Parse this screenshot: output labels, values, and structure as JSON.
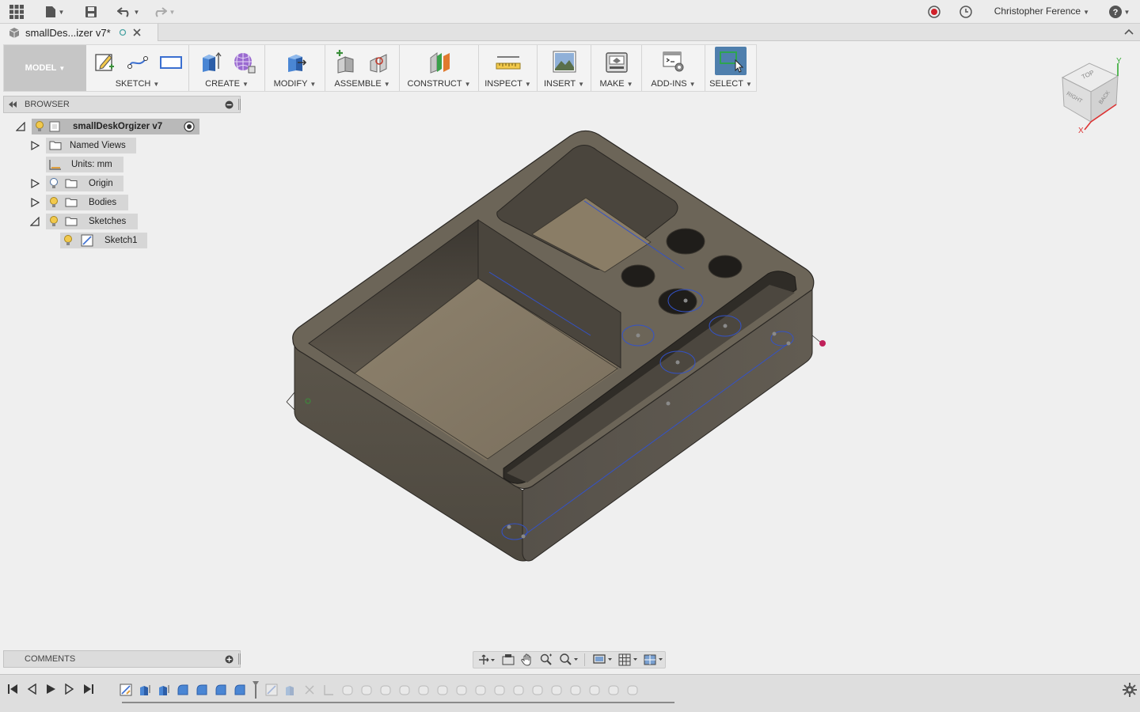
{
  "app": {
    "user_name": "Christopher Ference",
    "document_tab_title": "smallDes...izer v7*"
  },
  "ribbon": {
    "workspace_label": "MODEL",
    "groups": [
      {
        "label": "SKETCH",
        "icons": [
          "create-sketch-icon",
          "line-icon",
          "rectangle-icon"
        ]
      },
      {
        "label": "CREATE",
        "icons": [
          "extrude-icon",
          "form-icon"
        ]
      },
      {
        "label": "MODIFY",
        "icons": [
          "press-pull-icon"
        ]
      },
      {
        "label": "ASSEMBLE",
        "icons": [
          "new-component-icon",
          "joint-icon"
        ]
      },
      {
        "label": "CONSTRUCT",
        "icons": [
          "offset-plane-icon"
        ]
      },
      {
        "label": "INSPECT",
        "icons": [
          "measure-icon"
        ]
      },
      {
        "label": "INSERT",
        "icons": [
          "insert-image-icon"
        ]
      },
      {
        "label": "MAKE",
        "icons": [
          "print-3d-icon"
        ]
      },
      {
        "label": "ADD-INS",
        "icons": [
          "scripts-icon"
        ]
      },
      {
        "label": "SELECT",
        "icons": [
          "select-icon"
        ]
      }
    ]
  },
  "browser": {
    "title": "BROWSER",
    "root": "smallDeskOrgizer v7",
    "items": [
      {
        "label": "Named Views"
      },
      {
        "label": "Units: mm"
      },
      {
        "label": "Origin"
      },
      {
        "label": "Bodies"
      },
      {
        "label": "Sketches"
      },
      {
        "label": "Sketch1"
      }
    ]
  },
  "viewcube": {
    "faces": [
      "TOP",
      "RIGHT",
      "BACK"
    ],
    "axes": [
      "Y",
      "X"
    ]
  },
  "comments": {
    "title": "COMMENTS"
  },
  "colors": {
    "body": "#6c6558",
    "floor": "#8a7d66",
    "sketch_line": "#3352c8",
    "select_blue": "#4f7fad"
  }
}
